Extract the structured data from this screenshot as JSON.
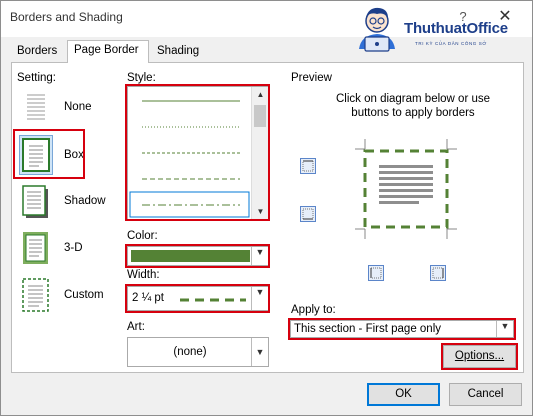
{
  "window": {
    "title": "Borders and Shading",
    "help_glyph": "?",
    "close_glyph": "✕",
    "brand": {
      "name": "ThuthuatOffice",
      "tagline": "TRI KỲ CỦA DÂN CÔNG SỞ"
    }
  },
  "tabs": [
    {
      "label": "Borders"
    },
    {
      "label": "Page Border",
      "selected": true
    },
    {
      "label": "Shading"
    }
  ],
  "setting": {
    "label": "Setting:",
    "options": [
      {
        "label": "None",
        "selected": false
      },
      {
        "label": "Box",
        "selected": true
      },
      {
        "label": "Shadow",
        "selected": false
      },
      {
        "label": "3-D",
        "selected": false
      },
      {
        "label": "Custom",
        "selected": false
      }
    ]
  },
  "style": {
    "label": "Style:"
  },
  "color": {
    "label": "Color:",
    "value_hex": "#548235"
  },
  "width": {
    "label": "Width:",
    "value": "2 ¼ pt"
  },
  "art": {
    "label": "Art:",
    "value": "(none)"
  },
  "preview": {
    "label": "Preview",
    "instructions": "Click on diagram below or use buttons to apply borders"
  },
  "apply_to": {
    "label": "Apply to:",
    "value": "This section - First page only"
  },
  "buttons": {
    "options": "Options...",
    "ok": "OK",
    "cancel": "Cancel"
  },
  "colors": {
    "highlight": "#d6000e",
    "accent": "#548235",
    "primary_button": "#0078d7",
    "brand": "#1e3f8a"
  }
}
